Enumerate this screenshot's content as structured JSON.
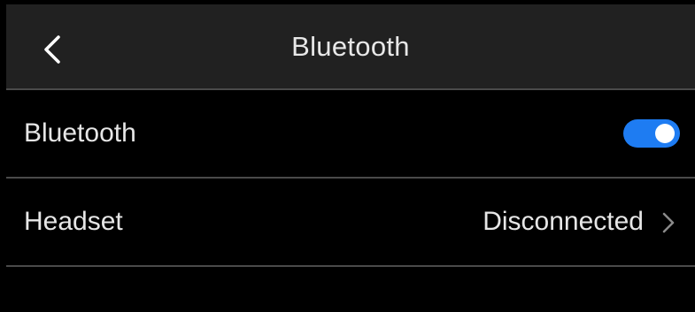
{
  "header": {
    "title": "Bluetooth",
    "back_icon": "chevron-left-icon"
  },
  "settings": {
    "bluetooth": {
      "label": "Bluetooth",
      "enabled": true
    },
    "headset": {
      "label": "Headset",
      "value": "Disconnected",
      "icon": "chevron-right-icon"
    }
  },
  "colors": {
    "header_background": "#212121",
    "background": "#000000",
    "divider": "#4a4a4a",
    "toggle_on": "#1e7cf2",
    "text": "#e6e6e6"
  }
}
